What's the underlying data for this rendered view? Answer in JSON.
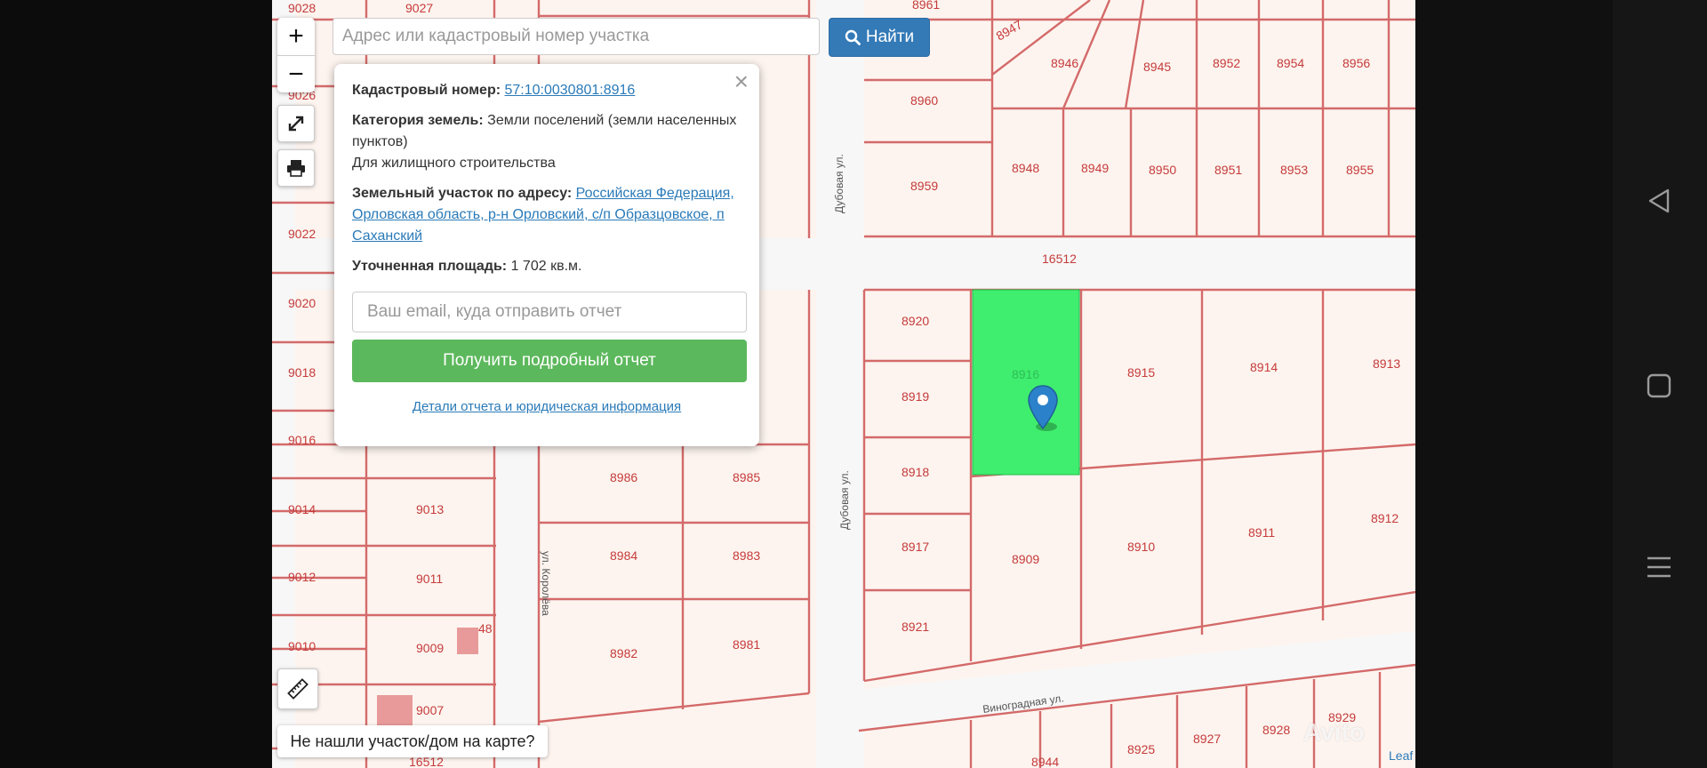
{
  "search": {
    "placeholder": "Адрес или кадастровый номер участка",
    "button_label": "Найти"
  },
  "controls": {
    "zoom_in": "+",
    "zoom_out": "−"
  },
  "popup": {
    "cadastral_label": "Кадастровый номер:",
    "cadastral_value": "57:10:0030801:8916",
    "category_label": "Категория земель:",
    "category_value": "Земли поселений (земли населенных пунктов)",
    "purpose": "Для жилищного строительства",
    "address_label": "Земельный участок по адресу:",
    "address_value": "Российская Федерация, Орловская область, р-н Орловский, с/п Образцовское, п Саханский",
    "area_label": "Уточненная площадь:",
    "area_value": "1 702 кв.м.",
    "email_placeholder": "Ваш email, куда отправить отчет",
    "report_button": "Получить подробный отчет",
    "details_link": "Детали отчета и юридическая информация",
    "close": "×"
  },
  "not_found": "Не нашли участок/дом на карте?",
  "watermark": "Avito",
  "attribution": "Leaf",
  "map": {
    "selected_plot": "8916",
    "plots": [
      "9028",
      "9027",
      "9026",
      "9022",
      "9020",
      "9018",
      "9016",
      "9014",
      "9013",
      "9012",
      "9011",
      "9010",
      "9009",
      "9007",
      "8961",
      "8960",
      "8959",
      "8947",
      "8946",
      "8945",
      "8952",
      "8954",
      "8956",
      "8948",
      "8949",
      "8950",
      "8951",
      "8953",
      "8955",
      "8920",
      "8919",
      "8918",
      "8917",
      "8921",
      "8915",
      "8914",
      "8913",
      "8909",
      "8910",
      "8911",
      "8912",
      "8986",
      "8985",
      "8984",
      "8983",
      "8982",
      "8981",
      "8944",
      "8925",
      "8927",
      "8928",
      "8929",
      "16512",
      "16512b",
      "48"
    ],
    "plot_labels": {
      "9028": "9028",
      "9027": "9027",
      "9026": "9026",
      "9022": "9022",
      "9020": "9020",
      "9018": "9018",
      "9016": "9016",
      "9014": "9014",
      "9013": "9013",
      "9012": "9012",
      "9011": "9011",
      "9010": "9010",
      "9009": "9009",
      "9007": "9007",
      "8961": "8961",
      "8960": "8960",
      "8959": "8959",
      "8947": "8947",
      "8946": "8946",
      "8945": "8945",
      "8952": "8952",
      "8954": "8954",
      "8956": "8956",
      "8948": "8948",
      "8949": "8949",
      "8950": "8950",
      "8951": "8951",
      "8953": "8953",
      "8955": "8955",
      "8920": "8920",
      "8919": "8919",
      "8918": "8918",
      "8917": "8917",
      "8921": "8921",
      "8915": "8915",
      "8914": "8914",
      "8913": "8913",
      "8909": "8909",
      "8910": "8910",
      "8911": "8911",
      "8912": "8912",
      "8986": "8986",
      "8985": "8985",
      "8984": "8984",
      "8983": "8983",
      "8982": "8982",
      "8981": "8981",
      "8944": "8944",
      "8925": "8925",
      "8927": "8927",
      "8928": "8928",
      "8929": "8929",
      "16512": "16512",
      "16512b": "16512",
      "48": "48",
      "8916": "8916"
    },
    "streets": {
      "dubovaya_1": "Дубовая ул.",
      "dubovaya_2": "Дубовая ул.",
      "koroleva": "ул. Королёва",
      "vinogradnaya": "Виноградная ул."
    }
  },
  "colors": {
    "plot_line": "#d46a6a",
    "selected_fill": "#3fee6e",
    "search_button": "#337ab7",
    "report_button": "#5cb85c",
    "link": "#2a7ab8"
  }
}
